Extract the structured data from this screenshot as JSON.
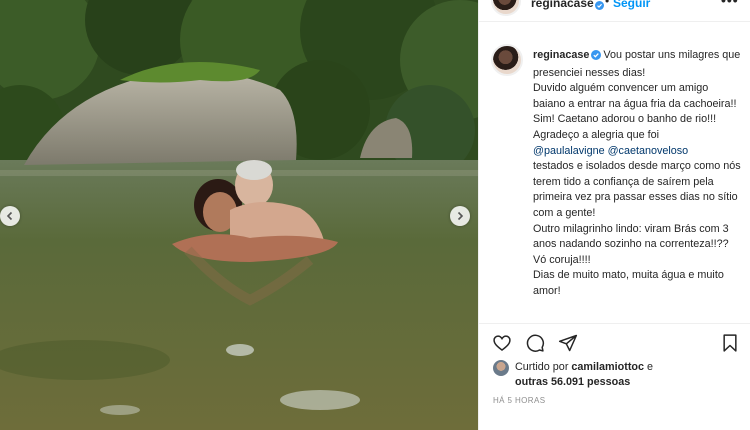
{
  "header": {
    "username": "reginacase",
    "follow_label": "Seguir",
    "more_label": "•••"
  },
  "caption": {
    "username": "reginacase",
    "text_part1": "Vou postar uns milagres que presenciei nesses dias!\nDuvido alguém convencer um amigo baiano a entrar na água fria da cachoeira!!\nSim! Caetano adorou o banho de rio!!!\nAgradeço a alegria que foi\n",
    "mention1": "@paulalavigne",
    "mention2": "@caetanoveloso",
    "text_part2": "\ntestados e isolados desde março como nós terem tido a confiança de saírem pela primeira vez pra passar esses dias no sítio com a gente!\nOutro milagrinho lindo: viram Brás com 3 anos nadando sozinho na correnteza!!??\nVó coruja!!!!\nDias de muito mato, muita água e muito amor!"
  },
  "likes": {
    "prefix": "Curtido por",
    "user": "camilamiottoc",
    "connector": "e",
    "others": "outras 56.091 pessoas"
  },
  "timestamp": "HÁ 5 HORAS",
  "icons": {
    "like": "heart-icon",
    "comment": "comment-icon",
    "share": "share-icon",
    "save": "bookmark-icon",
    "prev": "chevron-left-icon",
    "next": "chevron-right-icon",
    "verified": "verified-badge-icon"
  },
  "colors": {
    "link_blue": "#0095f6",
    "mention_blue": "#00376b",
    "verified_blue": "#3897f0",
    "muted_gray": "#8e8e8e"
  }
}
